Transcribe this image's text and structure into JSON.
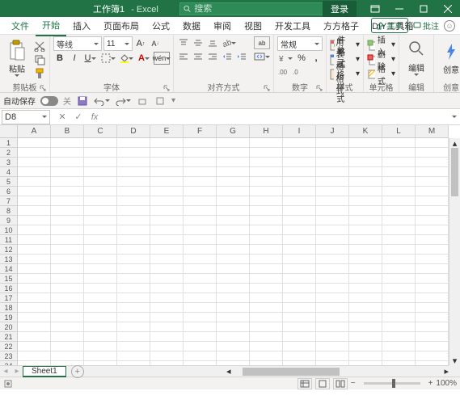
{
  "titlebar": {
    "filename": "工作簿1",
    "app": "Excel",
    "search_placeholder": "搜索",
    "login": "登录"
  },
  "tabs": {
    "file": "文件",
    "home": "开始",
    "insert": "插入",
    "layout": "页面布局",
    "formula": "公式",
    "data": "数据",
    "review": "审阅",
    "view": "视图",
    "dev": "开发工具",
    "square": "方方格子",
    "diy": "DIY工具箱",
    "share": "共享",
    "comments": "批注"
  },
  "ribbon": {
    "clipboard": {
      "paste": "粘贴",
      "label": "剪贴板"
    },
    "font": {
      "name": "等线",
      "size": "11",
      "label": "字体"
    },
    "align": {
      "wrap": "ab",
      "label": "对齐方式"
    },
    "number": {
      "format": "常规",
      "label": "数字"
    },
    "styles": {
      "cond": "条件格式",
      "table": "套用表格格式",
      "cell": "单元格样式",
      "label": "样式"
    },
    "cells_grp": {
      "insert": "插入",
      "delete": "删除",
      "format": "格式",
      "label": "单元格"
    },
    "editing": {
      "edit": "编辑",
      "label": "编辑"
    },
    "idea": {
      "idea": "创意",
      "label": "创意"
    }
  },
  "qat": {
    "autosave": "自动保存",
    "off": "关"
  },
  "namebox": "D8",
  "columns": [
    "A",
    "B",
    "C",
    "D",
    "E",
    "F",
    "G",
    "H",
    "I",
    "J",
    "K",
    "L",
    "M"
  ],
  "rows_count": 24,
  "sheet": {
    "name": "Sheet1"
  },
  "status": {
    "zoom": "100%"
  }
}
